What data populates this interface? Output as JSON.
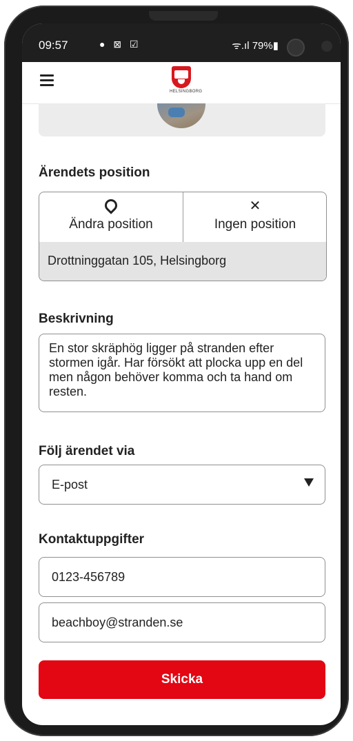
{
  "status_bar": {
    "time": "09:57",
    "left_icons": "● ⊠ ☑",
    "right": "ᯤ.ıl 79%▮"
  },
  "header": {
    "logo_text": "HELSINGBORG"
  },
  "position_section": {
    "title": "Ärendets position",
    "change_button": "Ändra position",
    "change_icon": "location-pin-icon",
    "none_button": "Ingen position",
    "none_icon": "close-icon",
    "none_glyph": "✕",
    "address": "Drottninggatan 105, Helsingborg"
  },
  "description_section": {
    "title": "Beskrivning",
    "value": "En stor skräphög ligger på stranden efter stormen igår. Har försökt att plocka upp en del men någon behöver komma och ta hand om resten."
  },
  "follow_section": {
    "title": "Följ ärendet via",
    "selected": "E-post"
  },
  "contact_section": {
    "title": "Kontaktuppgifter",
    "phone": "0123-456789",
    "email": "beachboy@stranden.se"
  },
  "submit": {
    "label": "Skicka",
    "color": "#e30613"
  }
}
